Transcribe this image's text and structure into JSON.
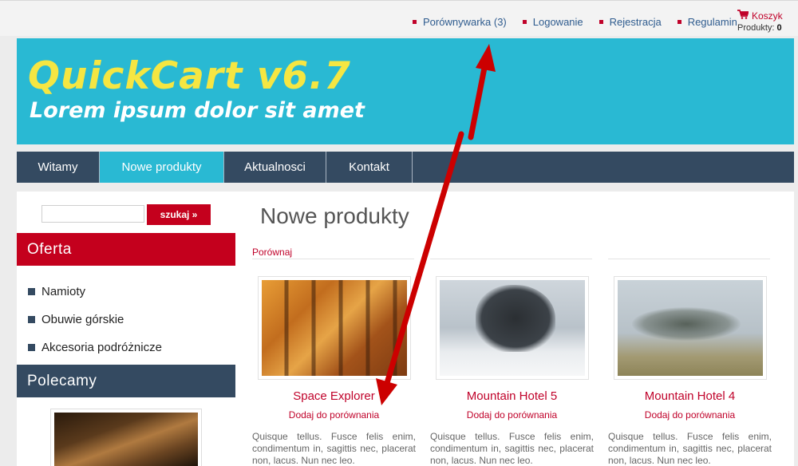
{
  "topbar": {
    "links": [
      {
        "label": "Porównywarka (3)"
      },
      {
        "label": "Logowanie"
      },
      {
        "label": "Rejestracja"
      },
      {
        "label": "Regulamin"
      }
    ],
    "cart": {
      "label": "Koszyk",
      "count_label": "Produkty:",
      "count_value": "0"
    }
  },
  "banner": {
    "title_part1": "Quick",
    "title_part2": "Cart",
    "title_part3": " v6.7",
    "subtitle": "Lorem ipsum dolor sit amet"
  },
  "nav": {
    "items": [
      {
        "label": "Witamy"
      },
      {
        "label": "Nowe produkty"
      },
      {
        "label": "Aktualnosci"
      },
      {
        "label": "Kontakt"
      }
    ]
  },
  "sidebar": {
    "search_value": "",
    "search_button": "szukaj »",
    "offer_heading": "Oferta",
    "categories": [
      {
        "label": "Namioty"
      },
      {
        "label": "Obuwie górskie"
      },
      {
        "label": "Akcesoria podróżnicze"
      }
    ],
    "recommend_heading": "Polecamy"
  },
  "main": {
    "title": "Nowe produkty",
    "compare_link": "Porównaj",
    "products": [
      {
        "name": "Space Explorer",
        "compare": "Dodaj do porównania",
        "description": "Quisque tellus. Fusce felis enim, condimentum in, sagittis nec, placerat non, lacus. Nun nec leo."
      },
      {
        "name": "Mountain Hotel 5",
        "compare": "Dodaj do porównania",
        "description": "Quisque tellus. Fusce felis enim, condimentum in, sagittis nec, placerat non, lacus. Nun nec leo."
      },
      {
        "name": "Mountain Hotel 4",
        "compare": "Dodaj do porównania",
        "description": "Quisque tellus. Fusce felis enim, condimentum in, sagittis nec, placerat non, lacus. Nun nec leo."
      }
    ]
  },
  "colors": {
    "brand_red": "#c4001d",
    "nav_navy": "#344a61",
    "accent_cyan": "#29b9d3",
    "link_blue": "#2e5b8e",
    "arrow_red": "#cc0000"
  },
  "icons": {
    "cart": "shopping-cart-icon",
    "bullet": "square-bullet-icon"
  }
}
